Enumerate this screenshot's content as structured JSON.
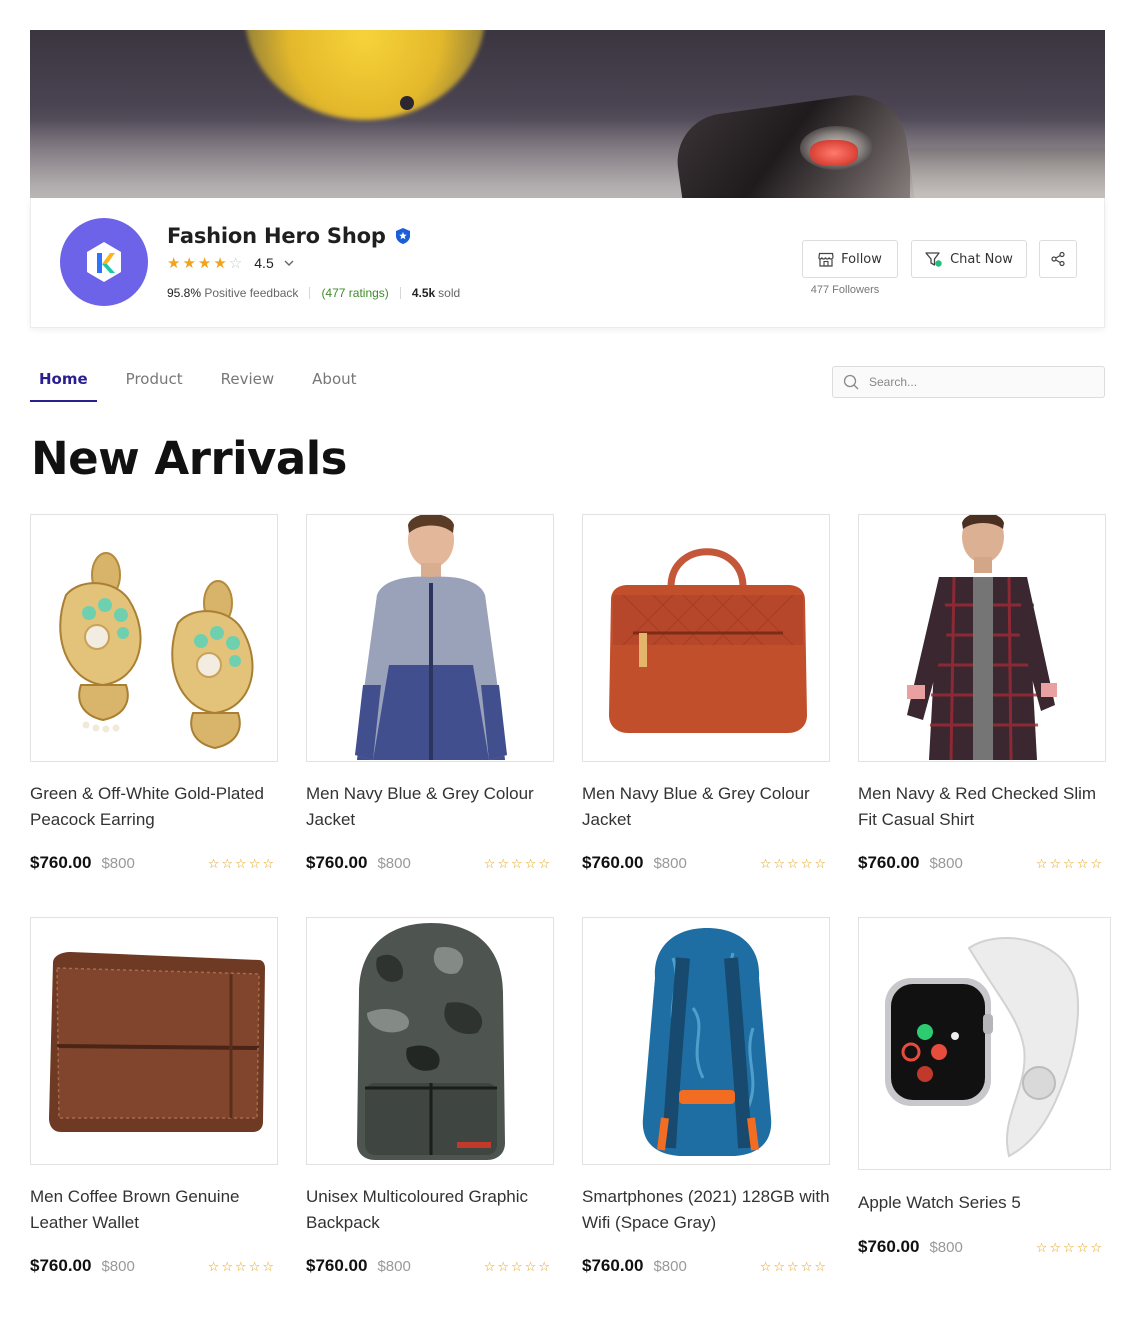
{
  "shop": {
    "name": "Fashion Hero Shop",
    "rating": "4.5",
    "rating_stars": 4,
    "positive_feedback_pct": "95.8%",
    "positive_feedback_label": "Positive feedback",
    "ratings_count": "(477 ratings)",
    "sold_count": "4.5k",
    "sold_label": "sold",
    "follow_label": "Follow",
    "chat_label": "Chat Now",
    "followers": "477 Followers",
    "brand_color": "#6c63e9",
    "verified_color": "#1a5fd8"
  },
  "nav": {
    "tabs": [
      {
        "label": "Home",
        "active": true
      },
      {
        "label": "Product",
        "active": false
      },
      {
        "label": "Review",
        "active": false
      },
      {
        "label": "About",
        "active": false
      }
    ],
    "search_placeholder": "Search..."
  },
  "section": {
    "title": "New Arrivals"
  },
  "products": [
    {
      "name": "Green & Off-White Gold-Plated Peacock Earring",
      "price": "$760.00",
      "old_price": "$800",
      "image": "earrings"
    },
    {
      "name": "Men Navy Blue & Grey Colour Jacket",
      "price": "$760.00",
      "old_price": "$800",
      "image": "jacket"
    },
    {
      "name": "Men Navy Blue & Grey Colour Jacket",
      "price": "$760.00",
      "old_price": "$800",
      "image": "handbag"
    },
    {
      "name": "Men Navy & Red Checked Slim Fit Casual Shirt",
      "price": "$760.00",
      "old_price": "$800",
      "image": "shirt"
    },
    {
      "name": "Men Coffee Brown Genuine Leather Wallet",
      "price": "$760.00",
      "old_price": "$800",
      "image": "wallet"
    },
    {
      "name": "Unisex Multicoloured Graphic Backpack",
      "price": "$760.00",
      "old_price": "$800",
      "image": "camo-backpack"
    },
    {
      "name": "Smartphones (2021) 128GB with Wifi (Space Gray)",
      "price": "$760.00",
      "old_price": "$800",
      "image": "blue-backpack"
    },
    {
      "name": "Apple Watch Series 5",
      "price": "$760.00",
      "old_price": "$800",
      "image": "watch"
    }
  ]
}
